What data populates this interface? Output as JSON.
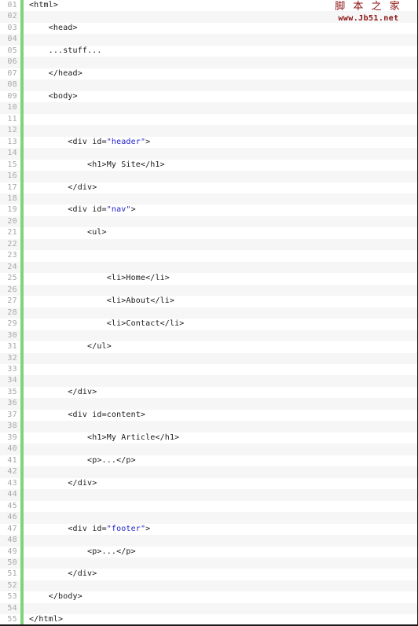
{
  "viewer": {
    "title": "HTML source code listing",
    "total_lines": 55,
    "gutter_bar_color": "#7cd47c",
    "line_number_color": "#a8a8a8",
    "code_color": "#1a1a1a",
    "string_color": "#2222cc",
    "row_alt_color": "#f6f6f6",
    "row_color": "#ffffff"
  },
  "watermark": {
    "chinese": "脚 本 之 家",
    "url": "www.Jb51.net",
    "color": "#8a1111"
  },
  "lines": [
    {
      "n": "01",
      "indent": 0,
      "text": "<html>"
    },
    {
      "n": "02",
      "indent": 0,
      "text": ""
    },
    {
      "n": "03",
      "indent": 1,
      "text": "<head>"
    },
    {
      "n": "04",
      "indent": 0,
      "text": ""
    },
    {
      "n": "05",
      "indent": 1,
      "text": "...stuff..."
    },
    {
      "n": "06",
      "indent": 0,
      "text": ""
    },
    {
      "n": "07",
      "indent": 1,
      "text": "</head>"
    },
    {
      "n": "08",
      "indent": 0,
      "text": ""
    },
    {
      "n": "09",
      "indent": 1,
      "text": "<body>"
    },
    {
      "n": "10",
      "indent": 0,
      "text": ""
    },
    {
      "n": "11",
      "indent": 0,
      "text": ""
    },
    {
      "n": "12",
      "indent": 0,
      "text": ""
    },
    {
      "n": "13",
      "indent": 2,
      "text": "<div id=",
      "str": "\"header\"",
      "tail": ">"
    },
    {
      "n": "14",
      "indent": 0,
      "text": ""
    },
    {
      "n": "15",
      "indent": 3,
      "text": "<h1>My Site</h1>"
    },
    {
      "n": "16",
      "indent": 0,
      "text": ""
    },
    {
      "n": "17",
      "indent": 2,
      "text": "</div>"
    },
    {
      "n": "18",
      "indent": 0,
      "text": ""
    },
    {
      "n": "19",
      "indent": 2,
      "text": "<div id=",
      "str": "\"nav\"",
      "tail": ">"
    },
    {
      "n": "20",
      "indent": 0,
      "text": ""
    },
    {
      "n": "21",
      "indent": 3,
      "text": "<ul>"
    },
    {
      "n": "22",
      "indent": 0,
      "text": ""
    },
    {
      "n": "23",
      "indent": 0,
      "text": ""
    },
    {
      "n": "24",
      "indent": 0,
      "text": ""
    },
    {
      "n": "25",
      "indent": 4,
      "text": "<li>Home</li>"
    },
    {
      "n": "26",
      "indent": 0,
      "text": ""
    },
    {
      "n": "27",
      "indent": 4,
      "text": "<li>About</li>"
    },
    {
      "n": "28",
      "indent": 0,
      "text": ""
    },
    {
      "n": "29",
      "indent": 4,
      "text": "<li>Contact</li>"
    },
    {
      "n": "30",
      "indent": 0,
      "text": ""
    },
    {
      "n": "31",
      "indent": 3,
      "text": "</ul>"
    },
    {
      "n": "32",
      "indent": 0,
      "text": ""
    },
    {
      "n": "33",
      "indent": 0,
      "text": ""
    },
    {
      "n": "34",
      "indent": 0,
      "text": ""
    },
    {
      "n": "35",
      "indent": 2,
      "text": "</div>"
    },
    {
      "n": "36",
      "indent": 0,
      "text": ""
    },
    {
      "n": "37",
      "indent": 2,
      "text": "<div id=content>"
    },
    {
      "n": "38",
      "indent": 0,
      "text": ""
    },
    {
      "n": "39",
      "indent": 3,
      "text": "<h1>My Article</h1>"
    },
    {
      "n": "40",
      "indent": 0,
      "text": ""
    },
    {
      "n": "41",
      "indent": 3,
      "text": "<p>...</p>"
    },
    {
      "n": "42",
      "indent": 0,
      "text": ""
    },
    {
      "n": "43",
      "indent": 2,
      "text": "</div>"
    },
    {
      "n": "44",
      "indent": 0,
      "text": ""
    },
    {
      "n": "45",
      "indent": 0,
      "text": ""
    },
    {
      "n": "46",
      "indent": 0,
      "text": ""
    },
    {
      "n": "47",
      "indent": 2,
      "text": "<div id=",
      "str": "\"footer\"",
      "tail": ">"
    },
    {
      "n": "48",
      "indent": 0,
      "text": ""
    },
    {
      "n": "49",
      "indent": 3,
      "text": "<p>...</p>"
    },
    {
      "n": "50",
      "indent": 0,
      "text": ""
    },
    {
      "n": "51",
      "indent": 2,
      "text": "</div>"
    },
    {
      "n": "52",
      "indent": 0,
      "text": ""
    },
    {
      "n": "53",
      "indent": 1,
      "text": "</body>"
    },
    {
      "n": "54",
      "indent": 0,
      "text": ""
    },
    {
      "n": "55",
      "indent": 0,
      "text": "</html>"
    }
  ]
}
